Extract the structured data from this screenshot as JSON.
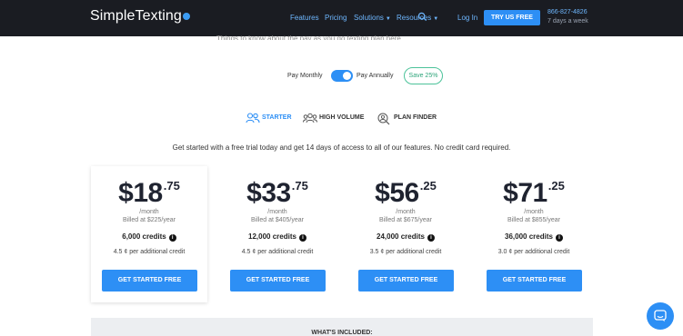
{
  "header": {
    "logo": "SimpleTexting",
    "nav": [
      "Features",
      "Pricing",
      "Solutions",
      "Resources",
      "Log In"
    ],
    "cta": "TRY US FREE",
    "phone": "866-827-4826",
    "hours": "7 days a week"
  },
  "intro_cut": "Things to know about the pay as you go texting plan here",
  "billing": {
    "monthly_label": "Pay Monthly",
    "annual_label": "Pay Annually",
    "save_badge": "Save 25%",
    "annual_selected": true
  },
  "tabs": [
    {
      "label": "STARTER",
      "icon": "users-icon",
      "active": true
    },
    {
      "label": "HIGH VOLUME",
      "icon": "group-icon",
      "active": false
    },
    {
      "label": "PLAN FINDER",
      "icon": "person-search-icon",
      "active": false
    }
  ],
  "trial_text": "Get started with a free trial today and get 14 days of access to all of our features. No credit card required.",
  "plans": [
    {
      "price": "$18",
      "cents": ".75",
      "per": "/month",
      "billed": "Billed at $225/year",
      "credits": "6,000 credits",
      "extra": "4.5 ¢ per additional credit",
      "cta": "GET STARTED FREE"
    },
    {
      "price": "$33",
      "cents": ".75",
      "per": "/month",
      "billed": "Billed at $405/year",
      "credits": "12,000 credits",
      "extra": "4.5 ¢ per additional credit",
      "cta": "GET STARTED FREE"
    },
    {
      "price": "$56",
      "cents": ".25",
      "per": "/month",
      "billed": "Billed at $675/year",
      "credits": "24,000 credits",
      "extra": "3.5 ¢ per additional credit",
      "cta": "GET STARTED FREE"
    },
    {
      "price": "$71",
      "cents": ".25",
      "per": "/month",
      "billed": "Billed at $855/year",
      "credits": "36,000 credits",
      "extra": "3.0 ¢ per additional credit",
      "cta": "GET STARTED FREE"
    }
  ],
  "included_heading": "WHAT'S INCLUDED:",
  "colors": {
    "header_bg": "#1a1c22",
    "accent": "#2d8ff5",
    "badge": "#4cc39a"
  }
}
